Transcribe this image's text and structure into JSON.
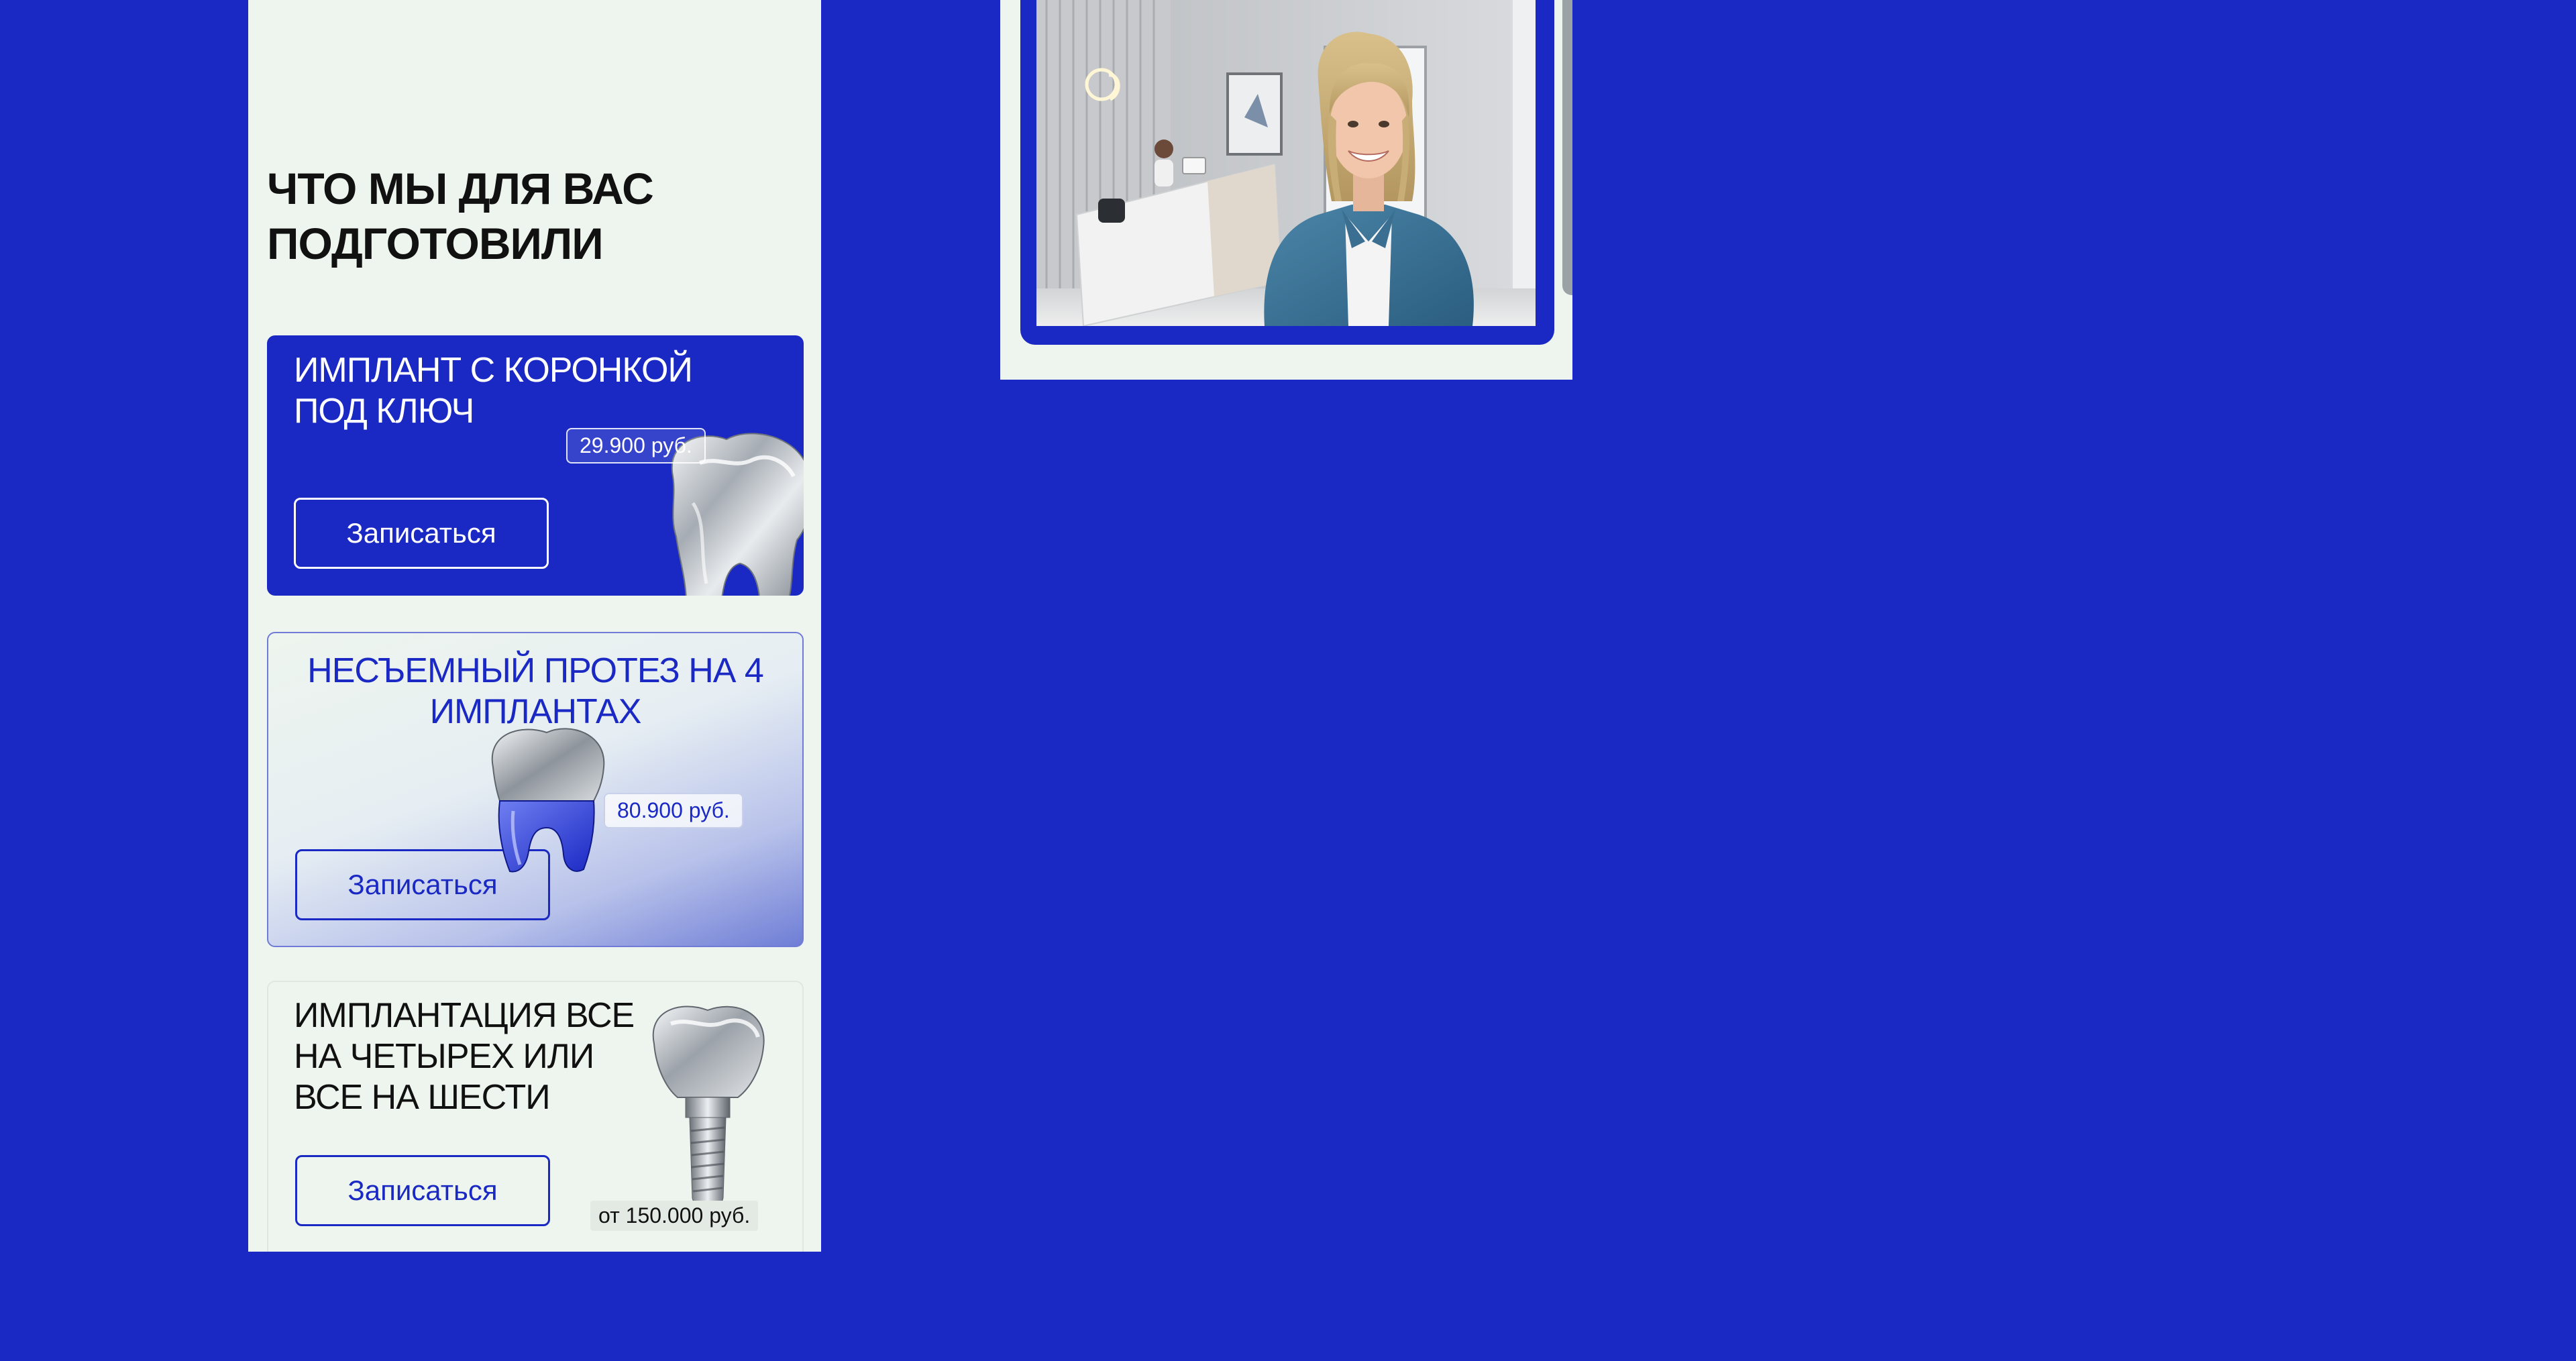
{
  "section": {
    "title": "ЧТО МЫ ДЛЯ ВАС ПОДГОТОВИЛИ"
  },
  "cards": [
    {
      "title": "ИМПЛАНТ С КОРОНКОЙ ПОД КЛЮЧ",
      "price": "29.900 руб.",
      "button_label": "Записаться",
      "image_icon": "silver-tooth-icon"
    },
    {
      "title": "НЕСЪЕМНЫЙ ПРОТЕЗ НА 4 ИМПЛАНТАХ",
      "price": "80.900 руб.",
      "button_label": "Записаться",
      "image_icon": "blue-silver-tooth-icon"
    },
    {
      "title": "ИМПЛАНТАЦИЯ ВСЕ НА ЧЕТЫРЕХ ИЛИ ВСЕ НА ШЕСТИ",
      "price": "от 150.000 руб.",
      "button_label": "Записаться",
      "image_icon": "tooth-implant-icon"
    }
  ],
  "photo": {
    "subject": "smiling-woman-clinic-photo"
  },
  "colors": {
    "background": "#1b29c4",
    "panel": "#eef5ee",
    "accent": "#1b29c4",
    "text_dark": "#111111"
  }
}
